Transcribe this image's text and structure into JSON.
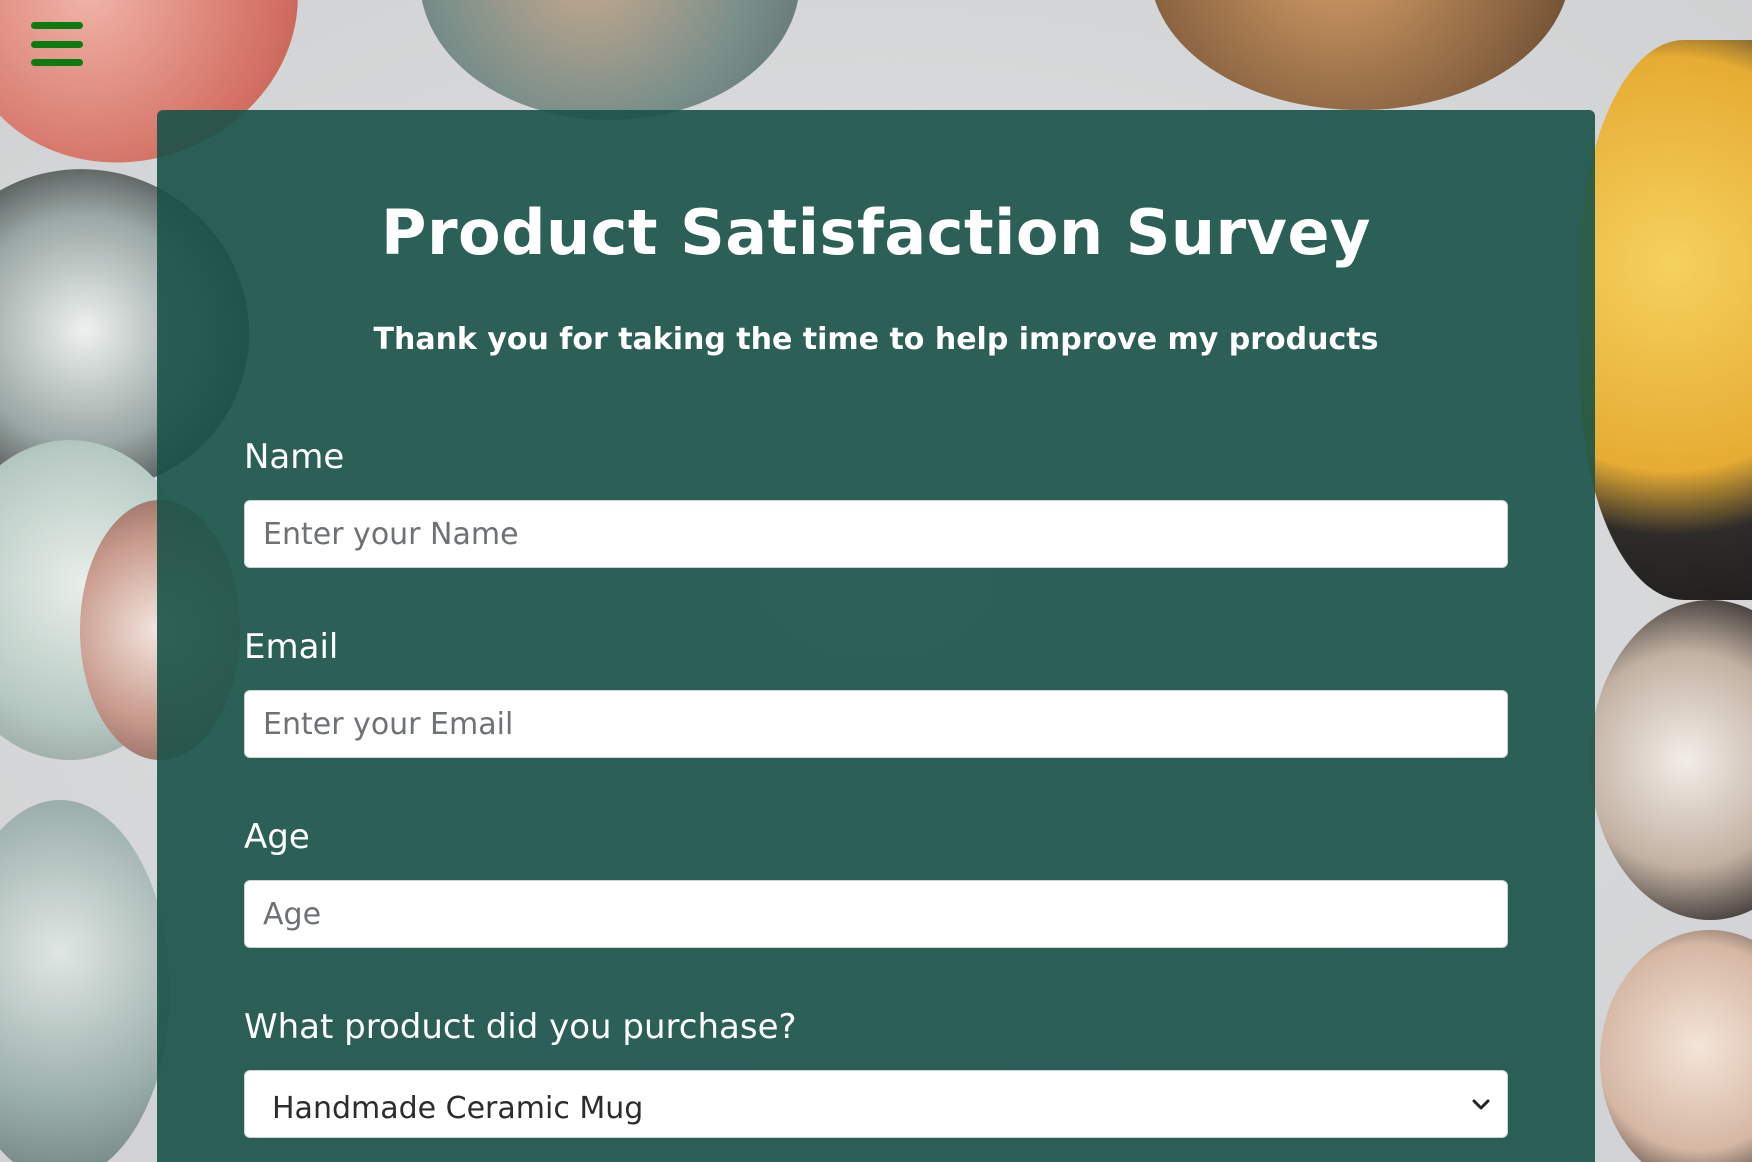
{
  "page": {
    "title": "Product Satisfaction Survey",
    "subtitle": "Thank you for taking the time to help improve my products"
  },
  "menu": {
    "icon": "hamburger-menu-icon",
    "color": "#0d7a12"
  },
  "form": {
    "name": {
      "label": "Name",
      "placeholder": "Enter your Name",
      "value": ""
    },
    "email": {
      "label": "Email",
      "placeholder": "Enter your Email",
      "value": ""
    },
    "age": {
      "label": "Age",
      "placeholder": "Age",
      "value": ""
    },
    "product": {
      "label": "What product did you purchase?",
      "selected": "Handmade Ceramic Mug",
      "icon": "chevron-down-icon"
    }
  },
  "theme": {
    "card_color": "#185248",
    "text_color": "#ffffff"
  }
}
